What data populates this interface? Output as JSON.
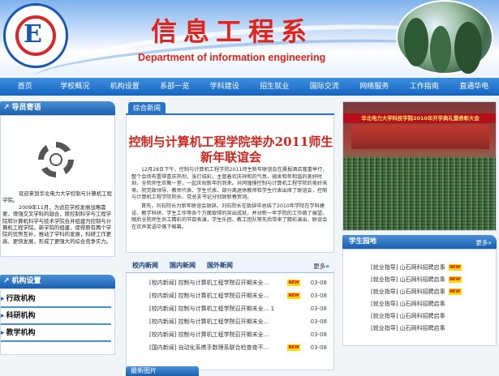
{
  "header": {
    "title": "信息工程系",
    "subtitle": "Department of information engineering",
    "logo_letter": "E",
    "logo_ring_text": "NORTH CHINA ELECTRIC POWER UNIVERSITY"
  },
  "nav": {
    "items": [
      "首页",
      "学校概况",
      "机构设置",
      "系部一览",
      "学科建设",
      "招生就业",
      "国际交流",
      "网络服务",
      "工作指南",
      "直通华电"
    ]
  },
  "guide": {
    "title": "导员寄语",
    "paragraphs": [
      "欢迎来到华北电力大学控制与计算机工程学院。",
      "2009年11月，为适应学校发展战略需要，增强交叉学科的融合，原控制科学与工程学院和计算机科学与技术学院合并组建为控制与计算机工程学院。新学院的组建，使得原有两个学院的优势互补，推动了学科的发展，科研工作更高、更快发展，形成了更强大的综合竞争实力。"
    ]
  },
  "org": {
    "title": "机构设置",
    "items": [
      "行政机构",
      "科研机构",
      "教学机构"
    ]
  },
  "news": {
    "tab": "综合新闻",
    "headline": "控制与计算机工程学院举办2011师生新年联谊会",
    "body": [
      "12月28日下午，控制与计算机工程学院2011师生新年联谊会在晨报酒店隆重举行，整个会场布置得喜庆热烈，张灯结彩。主管着欢庆祥和的气氛，宿舍和年和谐的美好时刻，全院师生欢聚一堂，一起庆祝新年的到来。共同憧憬控制与计算机工程学院的美好未来。院党政领导、教师代表、学生代表、部分离退休教师和学生代表出席了联谊会，控制与计算机工程学院院长、党总支书记分别致新春贺词。",
      "首先，刘石院长为新年联谊会致辞。刘石院长在致辞中总结了2010年学院在学科建设、教学科研、学生工作等各个方面取得的突出成就，并对新一年学院的工作做了展望。随后全院师生员工精彩的节目表演，学生乐团、教工团队等先后带来了精彩演出，联谊会在欢声笑语中落下帷幕。"
    ],
    "subtabs": [
      "校内新闻",
      "国内新闻",
      "国外新闻"
    ],
    "more": "更多",
    "list": [
      {
        "title": "[校内新闻] 控制与计算机工程学院召开期末全...",
        "date": "03-08",
        "is_new": true
      },
      {
        "title": "[校内新闻] 控制与计算机工程学院召开期末全...",
        "date": "03-08",
        "is_new": true
      },
      {
        "title": "[校内新闻] 控制与计算机工程学院召开期末全... 1",
        "date": "03-08",
        "is_new": false
      },
      {
        "title": "[校内新闻] 控制与计算机工程学院召开期末全...",
        "date": "03-08",
        "is_new": false
      },
      {
        "title": "[校内新闻] 控制与计算机工程学院召开期末全...",
        "date": "03-08",
        "is_new": false
      },
      {
        "title": "[国内新闻] 自动化系携手数理系联合检查夜不...",
        "date": "03-08",
        "is_new": true
      }
    ],
    "new_badge": "NEW"
  },
  "bottom_section": {
    "title": "最新图片"
  },
  "event_photo": {
    "banner": "华北电力大学科技学院2010年开学典礼暨表彰大会"
  },
  "student": {
    "title": "学生园地",
    "more": "更多",
    "items": [
      {
        "title": "[就业指导] 山石网科招聘启事",
        "is_new": true
      },
      {
        "title": "[就业指导] 山石网科招聘启事",
        "is_new": true
      },
      {
        "title": "[就业指导] 山石网科招聘启事",
        "is_new": true
      },
      {
        "title": "[就业指导] 山石网科招聘启事",
        "is_new": false
      },
      {
        "title": "[就业指导] 山石网科招聘启事",
        "is_new": false
      },
      {
        "title": "[就业指导] 山石网科招聘启事",
        "is_new": false
      }
    ]
  },
  "colors": {
    "accent": "#1b5fae",
    "title_red": "#e0241b",
    "badge_yellow": "#ffd800"
  }
}
